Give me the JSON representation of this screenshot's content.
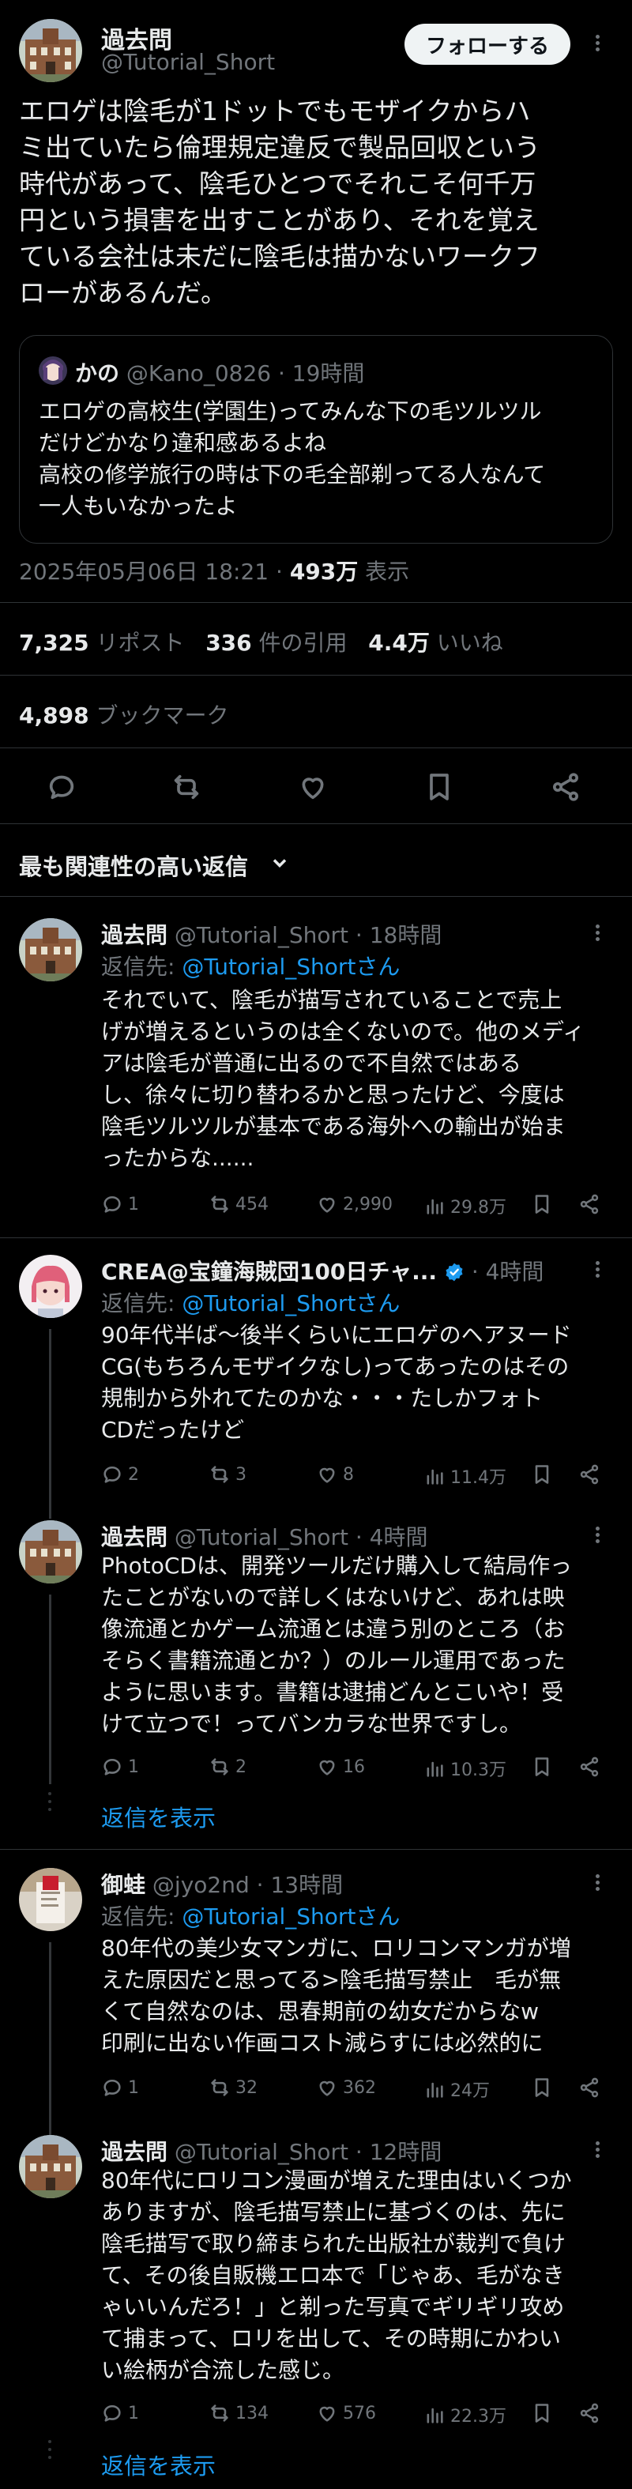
{
  "post": {
    "author_name": "過去問",
    "author_handle": "@Tutorial_Short",
    "follow_label": "フォローする",
    "text": "エロゲは陰毛が1ドットでもモザイクからハ\nミ出ていたら倫理規定違反で製品回収という\n時代があって、陰毛ひとつでそれこそ何千万\n円という損害を出すことがあり、それを覚え\nている会社は未だに陰毛は描かないワークフ\nローがあるんだ。",
    "quote": {
      "author_name": "かの",
      "author_handle": "@Kano_0826",
      "time": "· 19時間",
      "text": "エロゲの高校生(学園生)ってみんな下の毛ツルツル\nだけどかなり違和感あるよね\n高校の修学旅行の時は下の毛全部剃ってる人なんて\n一人もいなかったよ"
    },
    "datetime": "2025年05月06日 18:21 · ",
    "views_count": "493万",
    "views_label": " 表示",
    "reposts_count": "7,325",
    "reposts_label": " リポスト",
    "quotes_count": "336",
    "quotes_label": " 件の引用",
    "likes_count": "4.4万",
    "likes_label": " いいね",
    "bookmarks_count": "4,898",
    "bookmarks_label": " ブックマーク"
  },
  "sort_label": "最も関連性の高い返信",
  "replies": [
    {
      "name": "過去問",
      "handle": "@Tutorial_Short",
      "time": " · 18時間",
      "reply_to_prefix": "返信先: ",
      "reply_to": "@Tutorial_Shortさん",
      "text": "それでいて、陰毛が描写されていることで売上\nげが増えるというのは全くないので。他のメディ\nアは陰毛が普通に出るので不自然ではある\nし、徐々に切り替わるかと思ったけど、今度は\n陰毛ツルツルが基本である海外への輸出が始ま\nったからな......",
      "replies": "1",
      "reposts": "454",
      "likes": "2,990",
      "views": "29.8万"
    },
    {
      "name": "CREA@宝鐘海賊団100日チャ...",
      "handle": "",
      "time": " · 4時間",
      "reply_to_prefix": "返信先: ",
      "reply_to": "@Tutorial_Shortさん",
      "text": "90年代半ば〜後半くらいにエロゲのヘアヌード\nCG(もちろんモザイクなし)ってあったのはその\n規制から外れてたのかな・・・たしかフォト\nCDだったけど",
      "replies": "2",
      "reposts": "3",
      "likes": "8",
      "views": "11.4万"
    },
    {
      "name": "過去問",
      "handle": "@Tutorial_Short",
      "time": " · 4時間",
      "text": "PhotoCDは、開発ツールだけ購入して結局作っ\nたことがないので詳しくはないけど、あれは映\n像流通とかゲーム流通とは違う別のところ（お\nそらく書籍流通とか？）のルール運用であった\nように思います。書籍は逮捕どんとこいや！受\nけて立つで！ってバンカラな世界ですし。",
      "replies": "1",
      "reposts": "2",
      "likes": "16",
      "views": "10.3万",
      "show_replies": "返信を表示"
    },
    {
      "name": "御蛙",
      "handle": "@jyo2nd",
      "time": " · 13時間",
      "reply_to_prefix": "返信先: ",
      "reply_to": "@Tutorial_Shortさん",
      "text": "80年代の美少女マンガに、ロリコンマンガが増\nえた原因だと思ってる>陰毛描写禁止　毛が無\nくて自然なのは、思春期前の幼女だからなw\n印刷に出ない作画コスト減らすには必然的に",
      "replies": "1",
      "reposts": "32",
      "likes": "362",
      "views": "24万"
    },
    {
      "name": "過去問",
      "handle": "@Tutorial_Short",
      "time": " · 12時間",
      "text": "80年代にロリコン漫画が増えた理由はいくつか\nありますが、陰毛描写禁止に基づくのは、先に\n陰毛描写で取り締まられた出版社が裁判で負け\nて、その後自販機エロ本で「じゃあ、毛がなき\nゃいいんだろ！」と剃った写真でギリギリ攻め\nて捕まって、ロリを出して、その時期にかわい\nい絵柄が合流した感じ。",
      "replies": "1",
      "reposts": "134",
      "likes": "576",
      "views": "22.3万",
      "show_replies": "返信を表示"
    }
  ],
  "colors": {
    "bg": "#000000",
    "text": "#e7e9ea",
    "muted": "#71767b",
    "accent": "#1d9bf0",
    "border": "#2f3336"
  }
}
